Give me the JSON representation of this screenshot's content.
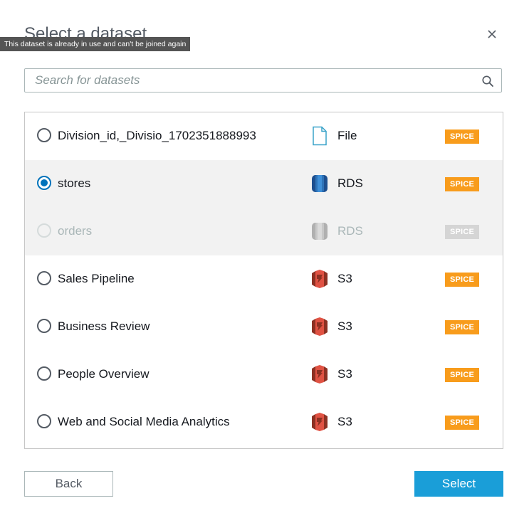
{
  "dialog": {
    "title": "Select a dataset",
    "tooltip": "This dataset is already in use and can't be joined again",
    "close_icon": "close-icon"
  },
  "search": {
    "placeholder": "Search for datasets",
    "value": "",
    "icon": "search-icon"
  },
  "colors": {
    "spice_badge": "#f89c1c",
    "spice_badge_disabled": "#d5d5d5",
    "selected_radio": "#0073bb",
    "primary_button": "#1a9ed8",
    "row_highlight": "#f2f2f2"
  },
  "datasets": [
    {
      "name": "Division_id,_Divisio_1702351888993",
      "source": "File",
      "source_icon": "file-icon",
      "badge": "SPICE",
      "state": "normal"
    },
    {
      "name": "stores",
      "source": "RDS",
      "source_icon": "rds-database-icon",
      "badge": "SPICE",
      "state": "selected"
    },
    {
      "name": "orders",
      "source": "RDS",
      "source_icon": "rds-database-icon",
      "badge": "SPICE",
      "state": "disabled"
    },
    {
      "name": "Sales Pipeline",
      "source": "S3",
      "source_icon": "s3-bucket-icon",
      "badge": "SPICE",
      "state": "normal"
    },
    {
      "name": "Business Review",
      "source": "S3",
      "source_icon": "s3-bucket-icon",
      "badge": "SPICE",
      "state": "normal"
    },
    {
      "name": "People Overview",
      "source": "S3",
      "source_icon": "s3-bucket-icon",
      "badge": "SPICE",
      "state": "normal"
    },
    {
      "name": "Web and Social Media Analytics",
      "source": "S3",
      "source_icon": "s3-bucket-icon",
      "badge": "SPICE",
      "state": "normal"
    }
  ],
  "buttons": {
    "back_label": "Back",
    "select_label": "Select"
  }
}
